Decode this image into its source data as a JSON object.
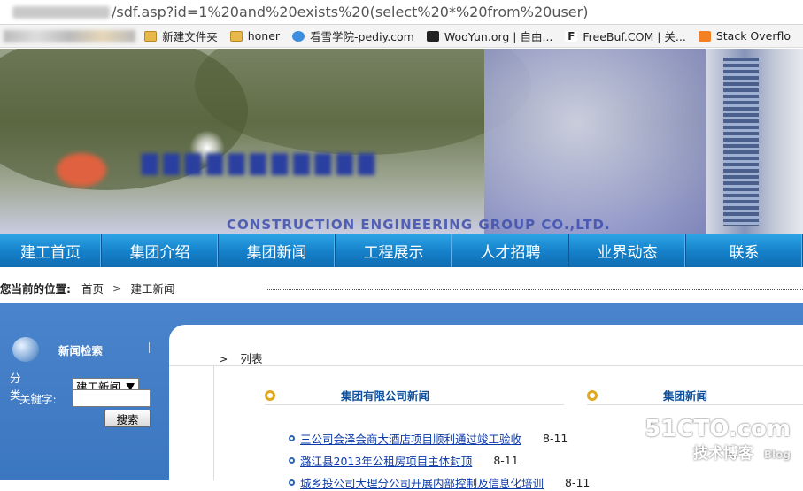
{
  "address_bar": {
    "url_visible": "/sdf.asp?id=1%20and%20exists%20(select%20*%20from%20user)"
  },
  "bookmarks": [
    {
      "label": "新建文件夹",
      "icon": "folder-icon"
    },
    {
      "label": "honer",
      "icon": "folder-icon"
    },
    {
      "label": "看雪学院-pediy.com",
      "icon": "snowflake-icon"
    },
    {
      "label": "WooYun.org | 自由...",
      "icon": "wooyun-icon"
    },
    {
      "label": "FreeBuf.COM | 关...",
      "icon": "freebuf-icon"
    },
    {
      "label": "Stack Overflo",
      "icon": "stackoverflow-icon"
    }
  ],
  "banner": {
    "subtitle": "CONSTRUCTION ENGINEERING GROUP CO.,LTD."
  },
  "nav": {
    "items": [
      "建工首页",
      "集团介绍",
      "集团新闻",
      "工程展示",
      "人才招聘",
      "业界动态",
      "联系"
    ]
  },
  "breadcrumb": {
    "label": "您当前的位置:",
    "home": "首页",
    "separator": ">",
    "current": "建工新闻"
  },
  "sidebar": {
    "title": "新闻检索",
    "category_label": "分 类:",
    "category_value": "建工新闻",
    "keyword_label": "关键字:",
    "search_button": "搜索"
  },
  "main": {
    "list_label": "列表",
    "section1": "集团有限公司新闻",
    "section2": "集团新闻",
    "news": [
      {
        "title": "三公司会泽会商大酒店项目顺利通过竣工验收",
        "date": "8-11"
      },
      {
        "title": "潞江县2013年公租房项目主体封顶",
        "date": "8-11"
      },
      {
        "title": "城乡投公司大理分公司开展内部控制及信息化培训",
        "date": "8-11"
      }
    ]
  },
  "watermark": {
    "site": "51CTO.com",
    "sub": "技术博客",
    "blog": "Blog"
  },
  "colors": {
    "nav_blue": "#1580c9",
    "link": "#0c3aa8",
    "section_title": "#0d4f9c",
    "bullet_ring": "#e0a91f",
    "content_bg": "#4a84cc"
  }
}
